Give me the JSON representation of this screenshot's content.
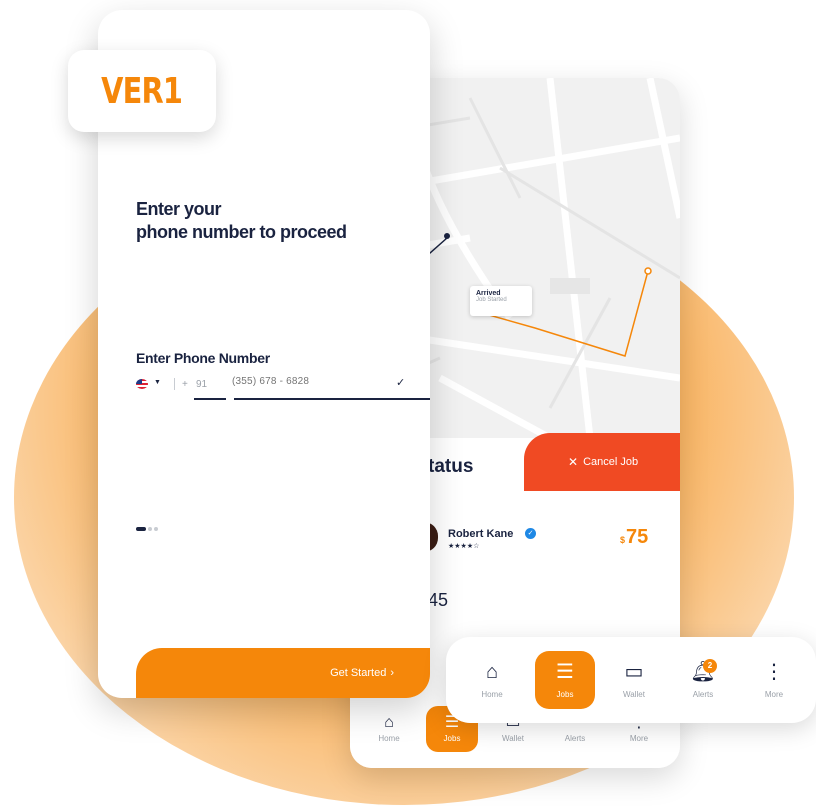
{
  "brand": {
    "logo": "VER1",
    "accent": "#f5870a",
    "danger": "#f04a23",
    "navy": "#1a2340"
  },
  "login": {
    "heading_line1": "Enter your",
    "heading_line2": "phone number to proceed",
    "field_label": "Enter Phone Number",
    "country_flag": "us-flag-icon",
    "country_code_prefix": "+",
    "country_code": "91",
    "phone_placeholder": "(355) 678 - 6828",
    "cta_label": "Get Started",
    "cta_icon": "chevron-right-icon"
  },
  "map": {
    "marker_title": "Arrived",
    "marker_subtitle": "Job Started"
  },
  "job_status": {
    "title": "tatus",
    "cancel_label": "Cancel Job",
    "driver_name": "Robert Kane",
    "rating": 4,
    "rating_display": "★★★★☆",
    "price_currency": "$",
    "price": "75",
    "eta_partial": "45"
  },
  "tab_bar": [
    {
      "label": "Home",
      "icon": "home-icon"
    },
    {
      "label": "Jobs",
      "icon": "jobs-icon",
      "active": true
    },
    {
      "label": "Wallet",
      "icon": "wallet-icon"
    },
    {
      "label": "Alerts",
      "icon": "bell-icon",
      "badge": "2"
    },
    {
      "label": "More",
      "icon": "more-icon"
    }
  ]
}
